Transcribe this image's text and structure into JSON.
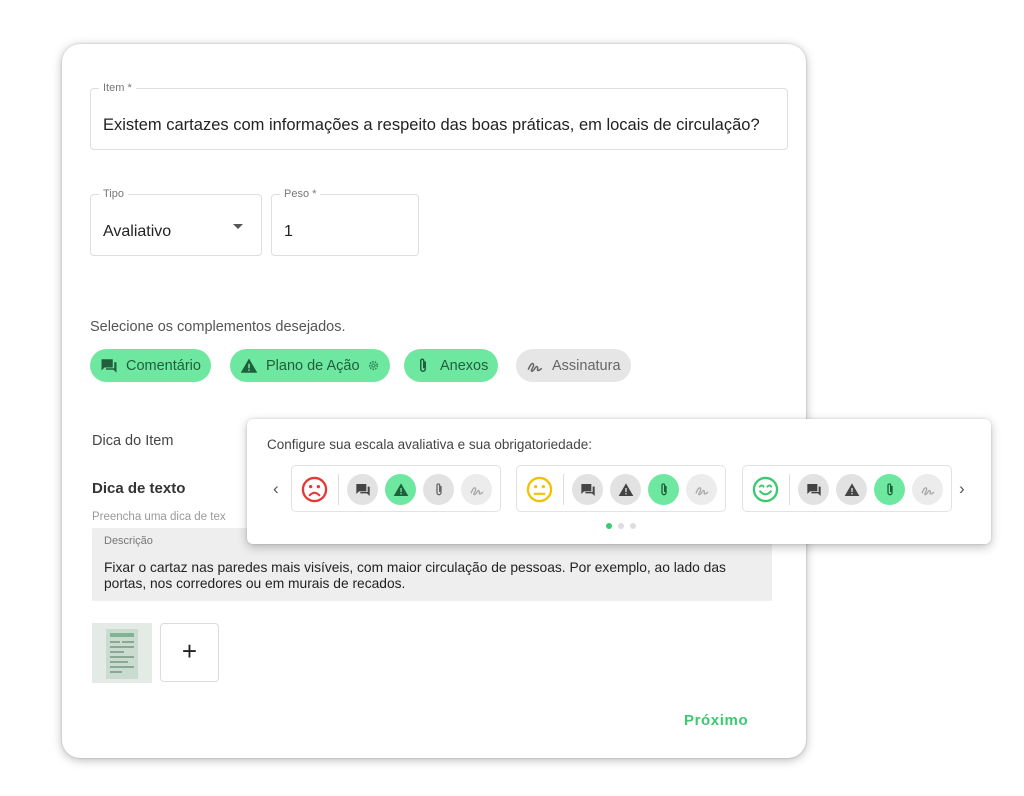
{
  "item": {
    "label": "Item *",
    "value": "Existem cartazes com informações a respeito das boas práticas, em locais de circulação?"
  },
  "tipo": {
    "label": "Tipo",
    "value": "Avaliativo"
  },
  "peso": {
    "label": "Peso *",
    "value": "1"
  },
  "complementos": {
    "label": "Selecione os complementos desejados.",
    "chips": [
      {
        "label": "Comentário",
        "icon": "comment-icon",
        "active": true
      },
      {
        "label": "Plano de Ação",
        "icon": "warning-icon",
        "active": true
      },
      {
        "label": "Anexos",
        "icon": "paperclip-icon",
        "active": true
      },
      {
        "label": "Assinatura",
        "icon": "signature-icon",
        "active": false
      }
    ]
  },
  "dica": {
    "section_label": "Dica do Item",
    "texto_label": "Dica de texto",
    "hint": "Preencha uma dica de tex",
    "description_label": "Descrição",
    "description": "Fixar o cartaz nas paredes mais visíveis, com maior circulação de pessoas. Por exemplo, ao lado das portas, nos corredores ou em murais de recados."
  },
  "attachments": {
    "add_label": "+"
  },
  "footer": {
    "next_label": "Próximo"
  },
  "scale_popup": {
    "title": "Configure sua escala avaliativa e sua obrigatoriedade:",
    "prev_label": "‹",
    "next_label": "›",
    "scales": [
      {
        "face": "sad-face-icon",
        "color": "#e53935",
        "options": {
          "comment": false,
          "action": true,
          "attach": false,
          "sign": false
        }
      },
      {
        "face": "neutral-face-icon",
        "color": "#f2c200",
        "options": {
          "comment": false,
          "action": false,
          "attach": true,
          "sign": false
        }
      },
      {
        "face": "happy-face-icon",
        "color": "#3cc96f",
        "options": {
          "comment": false,
          "action": false,
          "attach": true,
          "sign": false
        }
      }
    ],
    "pages": 3,
    "current_page": 1
  },
  "colors": {
    "accent": "#6ee8a0",
    "accent_dark": "#3cc96f",
    "chip_text": "#1f5f3a"
  }
}
